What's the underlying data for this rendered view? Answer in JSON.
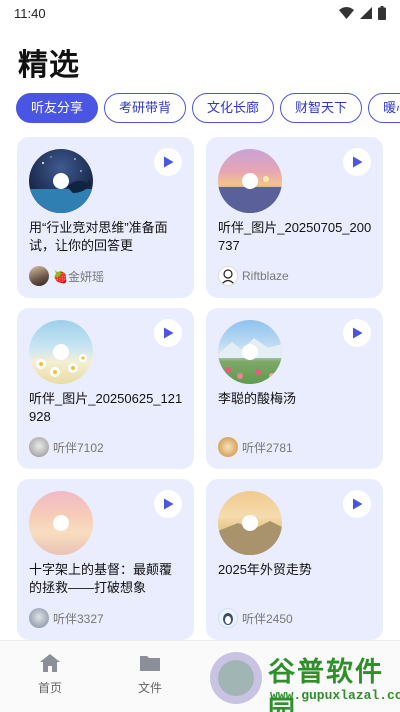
{
  "status_bar": {
    "time": "11:40",
    "icons": [
      "wifi-icon",
      "signal-icon",
      "battery-icon"
    ]
  },
  "page": {
    "title": "精选"
  },
  "tabs": [
    {
      "label": "听友分享",
      "active": true
    },
    {
      "label": "考研带背",
      "active": false
    },
    {
      "label": "文化长廊",
      "active": false
    },
    {
      "label": "财智天下",
      "active": false
    },
    {
      "label": "暖心·",
      "active": false
    }
  ],
  "cards": [
    {
      "title": "用“行业竞对思维”准备面试，让你的回答更",
      "author": "🍓金妍瑶",
      "cover": "whale-night-sea",
      "avatar": "portrait"
    },
    {
      "title": "听伴_图片_20250705_200737",
      "author": "Riftblaze",
      "cover": "purple-sunset",
      "avatar": "cartoon"
    },
    {
      "title": "听伴_图片_20250625_121928",
      "author": "听伴7102",
      "cover": "daisies-sky",
      "avatar": "kitten"
    },
    {
      "title": "李聪的酸梅汤",
      "author": "听伴2781",
      "cover": "mountain-flowers",
      "avatar": "shiba"
    },
    {
      "title": "十字架上的基督：最颠覆的拯救——打破想象",
      "author": "听伴3327",
      "cover": "pink-sky",
      "avatar": "kitten-grey"
    },
    {
      "title": "2025年外贸走势",
      "author": "听伴2450",
      "cover": "golden-field",
      "avatar": "penguin"
    }
  ],
  "bottom_nav": [
    {
      "label": "首页",
      "icon": "home-icon"
    },
    {
      "label": "文件",
      "icon": "folder-icon"
    }
  ],
  "watermark": {
    "text": "谷普软件园",
    "url": "www.gupuxlazal.com"
  },
  "colors": {
    "accent": "#4a55e3",
    "card_bg": "#eaedfd",
    "watermark": "#2f8f2a"
  }
}
